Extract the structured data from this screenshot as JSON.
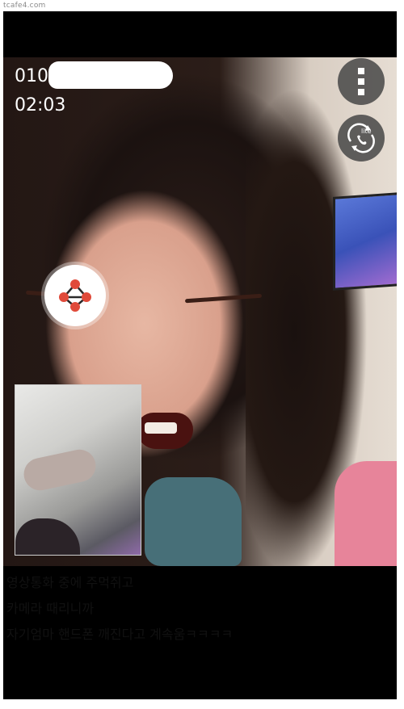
{
  "watermark": "tcafe4.com",
  "call": {
    "caller_number_visible": "010",
    "timer": "02:03"
  },
  "icons": {
    "menu": "more-vertical-icon",
    "switch": "swap-call-icon",
    "switch_badge_text": "lite",
    "share": "share-nodes-icon"
  },
  "colors": {
    "screen_bg": "#000000",
    "overlay_button": "#464646",
    "share_accent": "#e04a3a"
  },
  "caption": {
    "lines": [
      "영상통화 중에 주먹쥐고",
      "카메라 때리니까",
      "자기엄마 핸드폰 깨진다고 계속움ㅋㅋㅋㅋ"
    ]
  }
}
